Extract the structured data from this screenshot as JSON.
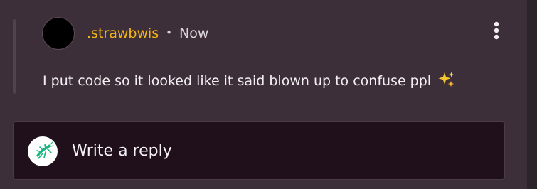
{
  "comment": {
    "username": ".strawbwis",
    "separator": "•",
    "timestamp": "Now",
    "text": "I put code so it looked like it said blown up to confuse ppl",
    "emoji_icon": "sparkles-icon",
    "more_icon": "vertical-ellipsis-icon"
  },
  "reply": {
    "placeholder": "Write a reply",
    "avatar_icon": "green-insect-icon"
  },
  "colors": {
    "background": "#3d2f39",
    "reply_background": "#1f101b",
    "username": "#f5b614",
    "text": "#f3eef2",
    "avatar": "#000000",
    "reply_icon": "#1fb47c"
  }
}
